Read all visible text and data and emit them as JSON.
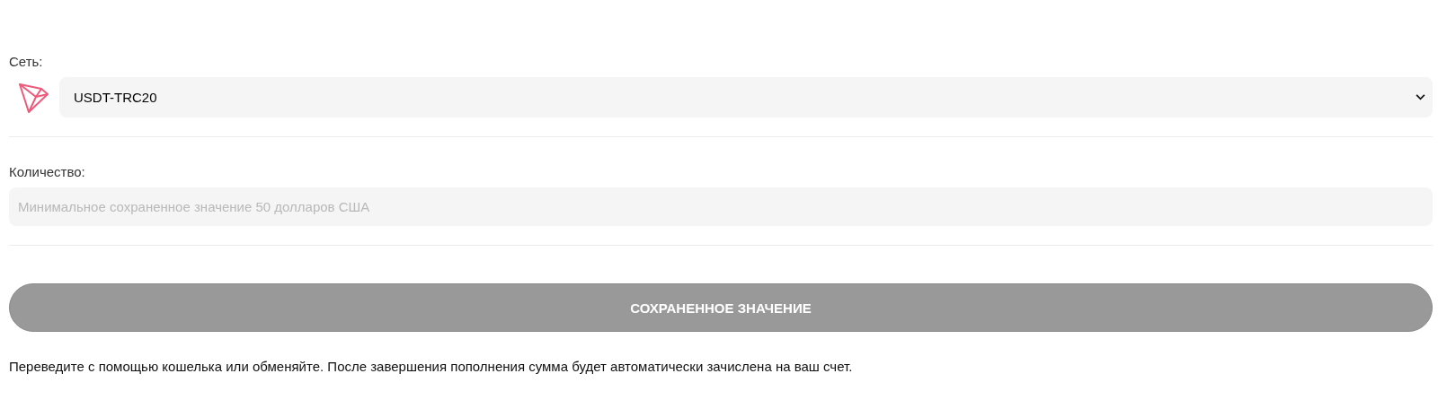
{
  "network": {
    "label": "Сеть:",
    "value": "USDT-TRC20"
  },
  "amount": {
    "label": "Количество:",
    "placeholder": "Минимальное сохраненное значение 50 долларов США"
  },
  "submit": {
    "label": "СОХРАНЕННОЕ ЗНАЧЕНИЕ",
    "disabled": true
  },
  "note": "Переведите с помощью кошелька или обменяйте. После завершения пополнения сумма будет автоматически зачислена на ваш счет."
}
